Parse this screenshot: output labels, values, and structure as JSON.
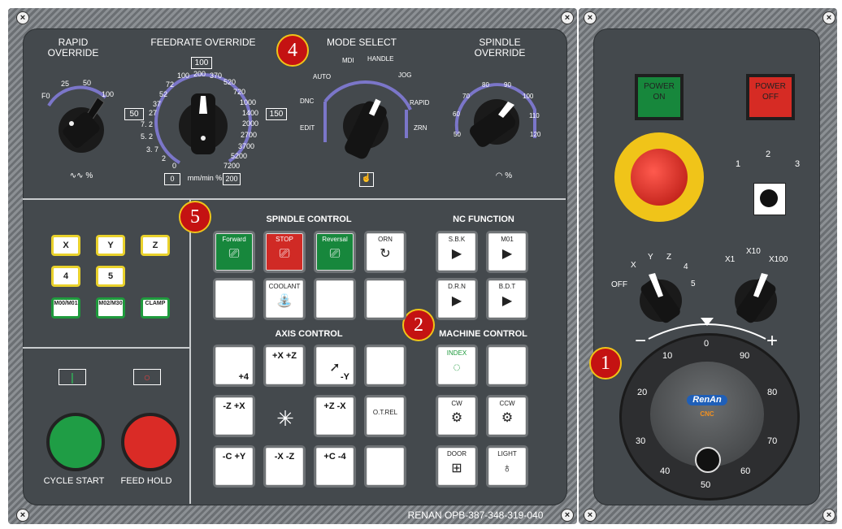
{
  "panel": {
    "footer_text": "RENAN OPB-387-348-319-040",
    "screw_glyph": "×"
  },
  "top": {
    "rapid": {
      "title": "RAPID\nOVERRIDE",
      "ticks": [
        "F0",
        "25",
        "50",
        "100"
      ],
      "unit": "∿∿ %"
    },
    "feed": {
      "title": "FEEDRATE OVERRIDE",
      "ticks": [
        "100",
        "200",
        "370",
        "520",
        "720",
        "1000",
        "1400",
        "2000",
        "2700",
        "3700",
        "5200",
        "7200",
        "72",
        "52",
        "37",
        "27",
        "14",
        "7. 2",
        "5. 2",
        "3. 7",
        "2",
        "0"
      ],
      "box_top": "100",
      "box_left": "50",
      "box_right": "150",
      "box_bl": "0",
      "box_br": "200",
      "unit": "mm/min %"
    },
    "mode": {
      "title": "MODE SELECT",
      "items": [
        "AUTO",
        "MDI",
        "HANDLE",
        "JOG",
        "RAPID",
        "ZRN",
        "DNC",
        "EDIT"
      ]
    },
    "spindle": {
      "title": "SPINDLE\nOVERRIDE",
      "ticks": [
        "50",
        "60",
        "70",
        "80",
        "90",
        "100",
        "110",
        "120"
      ],
      "unit": "%"
    }
  },
  "badges": {
    "b1": "1",
    "b2": "2",
    "b4": "4",
    "b5": "5"
  },
  "left": {
    "axis_keys": [
      "X",
      "Y",
      "Z",
      "4",
      "5"
    ],
    "m_keys": [
      "M00/M01",
      "M02/M30",
      "CLAMP"
    ],
    "cycle_start": "CYCLE START",
    "feed_hold": "FEED HOLD"
  },
  "spindle_control": {
    "title": "SPINDLE CONTROL",
    "buttons": [
      "Forward",
      "STOP",
      "Reversal",
      "ORN",
      "",
      "COOLANT",
      "",
      ""
    ]
  },
  "nc_function": {
    "title": "NC FUNCTION",
    "buttons": [
      "S.B.K",
      "M01",
      "D.R.N",
      "B.D.T"
    ]
  },
  "axis_control": {
    "title": "AXIS CONTROL",
    "buttons": [
      "+4",
      "+X +Z",
      "-Y",
      "",
      "-Z +X",
      "",
      "+Z -X",
      "O.T.REL",
      "-C +Y",
      "-X -Z",
      "+C -4",
      ""
    ]
  },
  "machine_control": {
    "title": "MACHINE CONTROL",
    "buttons": [
      "INDEX",
      "",
      "CW",
      "CCW",
      "DOOR",
      "LIGHT"
    ]
  },
  "right": {
    "power_on": "POWER\nON",
    "power_off": "POWER\nOFF",
    "selector": [
      "1",
      "2",
      "3"
    ],
    "axis_sel": [
      "OFF",
      "X",
      "Y",
      "Z",
      "4",
      "5"
    ],
    "mult_sel": [
      "X1",
      "X10",
      "X100"
    ],
    "mpg_minus": "−",
    "mpg_plus": "+",
    "mpg_ticks": [
      "0",
      "10",
      "20",
      "30",
      "40",
      "50",
      "60",
      "70",
      "80",
      "90"
    ],
    "mpg_logo": "RenAn",
    "mpg_logo2": "CNC"
  },
  "colors": {
    "panel": "#44494d",
    "green": "#17873c",
    "red": "#d02a25",
    "accent": "#7b76c9"
  }
}
